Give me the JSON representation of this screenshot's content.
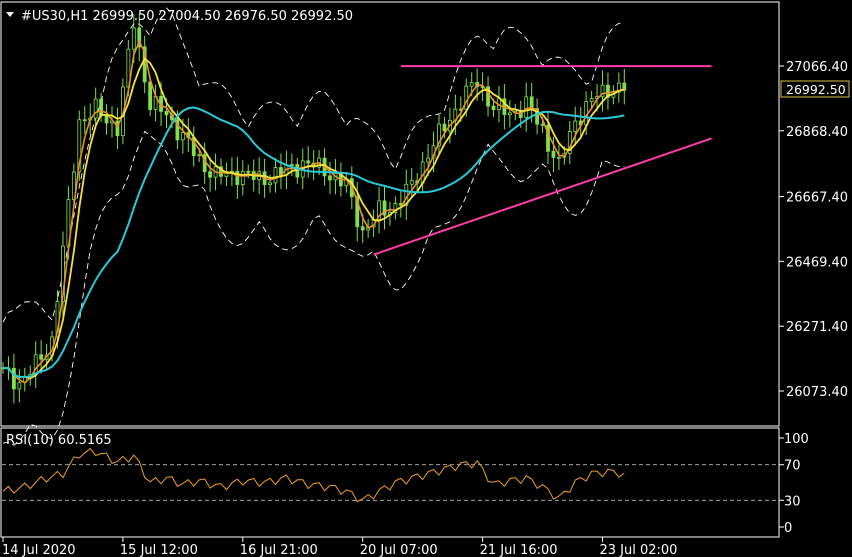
{
  "window": {
    "symbol_header": "#US30,H1  26999.50 27004.50 26976.50 26992.50",
    "menu_icon": "triangle-down-icon"
  },
  "chart_data": [
    {
      "type": "candlestick",
      "title": "#US30,H1",
      "ohlc_last": {
        "open": 26999.5,
        "high": 27004.5,
        "low": 26976.5,
        "close": 26992.5
      },
      "price_scale": {
        "ticks": [
          "27066.40",
          "26868.40",
          "26667.40",
          "26469.40",
          "26271.40",
          "26073.40"
        ],
        "ylim": [
          25990,
          27300
        ],
        "current_price": "26992.50"
      },
      "time_axis": {
        "labels": [
          "14 Jul 2020",
          "15 Jul 12:00",
          "16 Jul 21:00",
          "20 Jul 07:00",
          "21 Jul 16:00",
          "23 Jul 02:00"
        ],
        "label_bars": [
          0,
          22,
          44,
          66,
          88,
          110
        ]
      },
      "colors": {
        "candles": "#7fe04a",
        "ma_fast": "#e8902a",
        "ma_mid": "#f5e23c",
        "ma_slow": "#2bc9d8",
        "envelope": "#ffffff",
        "trendline": "#ff3ca8",
        "rsi": "#f0a020",
        "price_box_border": "#e0c040"
      },
      "price_series": [
        {
          "bar": 0,
          "price": 26130
        },
        {
          "bar": 3,
          "price": 26100
        },
        {
          "bar": 6,
          "price": 26150
        },
        {
          "bar": 9,
          "price": 26230
        },
        {
          "bar": 11,
          "price": 26500
        },
        {
          "bar": 14,
          "price": 26900
        },
        {
          "bar": 17,
          "price": 26930
        },
        {
          "bar": 21,
          "price": 26880
        },
        {
          "bar": 24,
          "price": 27200
        },
        {
          "bar": 27,
          "price": 26950
        },
        {
          "bar": 30,
          "price": 26920
        },
        {
          "bar": 33,
          "price": 26850
        },
        {
          "bar": 36,
          "price": 26780
        },
        {
          "bar": 39,
          "price": 26730
        },
        {
          "bar": 43,
          "price": 26740
        },
        {
          "bar": 47,
          "price": 26720
        },
        {
          "bar": 51,
          "price": 26740
        },
        {
          "bar": 55,
          "price": 26770
        },
        {
          "bar": 59,
          "price": 26750
        },
        {
          "bar": 63,
          "price": 26700
        },
        {
          "bar": 66,
          "price": 26560
        },
        {
          "bar": 69,
          "price": 26620
        },
        {
          "bar": 72,
          "price": 26640
        },
        {
          "bar": 75,
          "price": 26700
        },
        {
          "bar": 78,
          "price": 26800
        },
        {
          "bar": 81,
          "price": 26880
        },
        {
          "bar": 84,
          "price": 26960
        },
        {
          "bar": 87,
          "price": 27020
        },
        {
          "bar": 90,
          "price": 26940
        },
        {
          "bar": 93,
          "price": 26920
        },
        {
          "bar": 96,
          "price": 26950
        },
        {
          "bar": 99,
          "price": 26870
        },
        {
          "bar": 102,
          "price": 26760
        },
        {
          "bar": 105,
          "price": 26900
        },
        {
          "bar": 108,
          "price": 26960
        },
        {
          "bar": 111,
          "price": 27000
        },
        {
          "bar": 114,
          "price": 26992
        }
      ],
      "trendlines": [
        {
          "kind": "resistance",
          "from": {
            "bar": 73,
            "price": 27066
          },
          "to": {
            "bar": 130,
            "price": 27066
          }
        },
        {
          "kind": "support",
          "from": {
            "bar": 68,
            "price": 26490
          },
          "to": {
            "bar": 130,
            "price": 26845
          }
        }
      ]
    },
    {
      "type": "line",
      "title": "RSI(10) 60.5165",
      "indicator": "RSI(10)",
      "last_value": 60.5165,
      "ylim": [
        0,
        100
      ],
      "y_ticks": [
        "100",
        "70",
        "30",
        "0"
      ],
      "levels": [
        70,
        30
      ],
      "series": [
        {
          "bar": 0,
          "value": 40
        },
        {
          "bar": 4,
          "value": 45
        },
        {
          "bar": 8,
          "value": 55
        },
        {
          "bar": 11,
          "value": 60
        },
        {
          "bar": 14,
          "value": 82
        },
        {
          "bar": 17,
          "value": 85
        },
        {
          "bar": 21,
          "value": 73
        },
        {
          "bar": 24,
          "value": 80
        },
        {
          "bar": 27,
          "value": 50
        },
        {
          "bar": 30,
          "value": 55
        },
        {
          "bar": 33,
          "value": 48
        },
        {
          "bar": 36,
          "value": 52
        },
        {
          "bar": 40,
          "value": 45
        },
        {
          "bar": 44,
          "value": 52
        },
        {
          "bar": 48,
          "value": 50
        },
        {
          "bar": 52,
          "value": 55
        },
        {
          "bar": 56,
          "value": 48
        },
        {
          "bar": 60,
          "value": 45
        },
        {
          "bar": 63,
          "value": 40
        },
        {
          "bar": 66,
          "value": 30
        },
        {
          "bar": 69,
          "value": 40
        },
        {
          "bar": 72,
          "value": 50
        },
        {
          "bar": 75,
          "value": 55
        },
        {
          "bar": 78,
          "value": 60
        },
        {
          "bar": 81,
          "value": 65
        },
        {
          "bar": 84,
          "value": 70
        },
        {
          "bar": 87,
          "value": 72
        },
        {
          "bar": 90,
          "value": 48
        },
        {
          "bar": 93,
          "value": 52
        },
        {
          "bar": 96,
          "value": 55
        },
        {
          "bar": 99,
          "value": 45
        },
        {
          "bar": 102,
          "value": 32
        },
        {
          "bar": 105,
          "value": 50
        },
        {
          "bar": 108,
          "value": 60
        },
        {
          "bar": 111,
          "value": 62
        },
        {
          "bar": 114,
          "value": 60.5
        }
      ]
    }
  ]
}
